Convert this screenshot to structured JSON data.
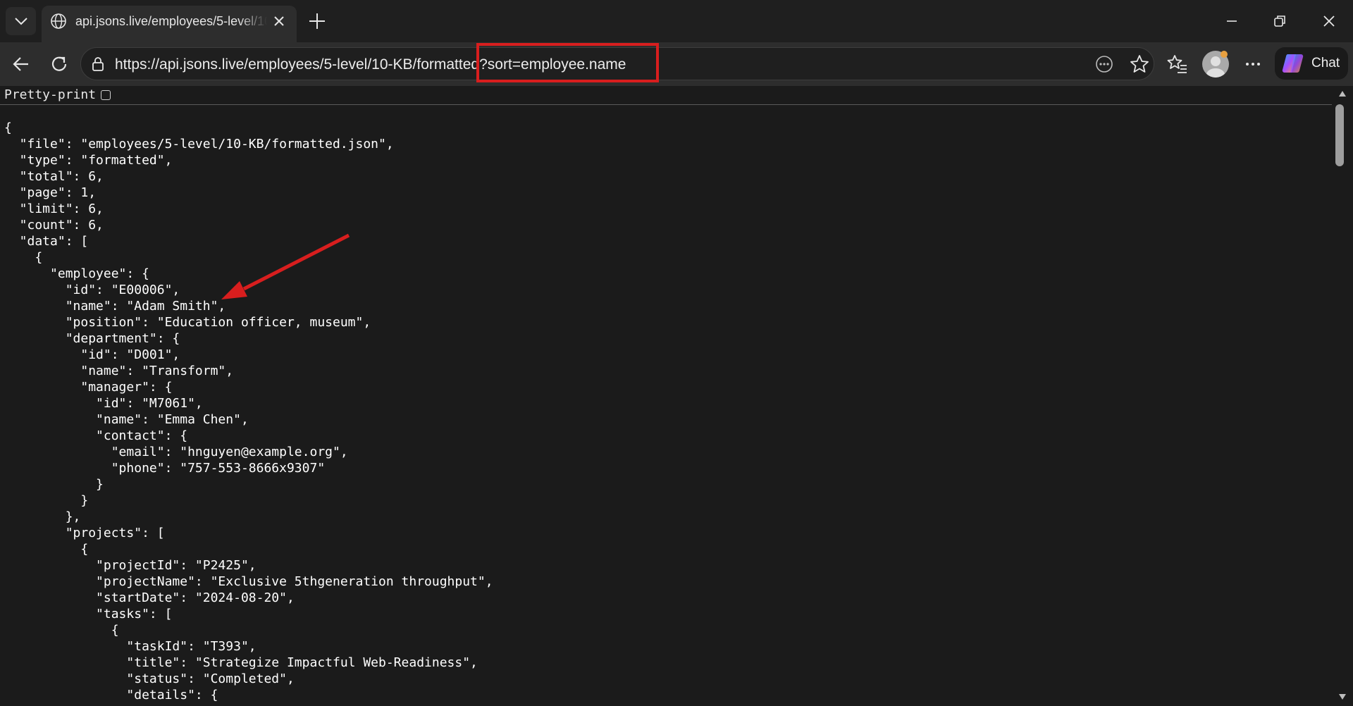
{
  "tab": {
    "title": "api.jsons.live/employees/5-level/10-KB/formatted?sort=employee.name"
  },
  "toolbar": {
    "url": "https://api.jsons.live/employees/5-level/10-KB/formatted?sort=employee.name",
    "chat_label": "Chat"
  },
  "content": {
    "pretty_print_label": "Pretty-print",
    "pretty_print_checked": false,
    "json_lines": [
      "{",
      "  \"file\": \"employees/5-level/10-KB/formatted.json\",",
      "  \"type\": \"formatted\",",
      "  \"total\": 6,",
      "  \"page\": 1,",
      "  \"limit\": 6,",
      "  \"count\": 6,",
      "  \"data\": [",
      "    {",
      "      \"employee\": {",
      "        \"id\": \"E00006\",",
      "        \"name\": \"Adam Smith\",",
      "        \"position\": \"Education officer, museum\",",
      "        \"department\": {",
      "          \"id\": \"D001\",",
      "          \"name\": \"Transform\",",
      "          \"manager\": {",
      "            \"id\": \"M7061\",",
      "            \"name\": \"Emma Chen\",",
      "            \"contact\": {",
      "              \"email\": \"hnguyen@example.org\",",
      "              \"phone\": \"757-553-8666x9307\"",
      "            }",
      "          }",
      "        },",
      "        \"projects\": [",
      "          {",
      "            \"projectId\": \"P2425\",",
      "            \"projectName\": \"Exclusive 5thgeneration throughput\",",
      "            \"startDate\": \"2024-08-20\",",
      "            \"tasks\": [",
      "              {",
      "                \"taskId\": \"T393\",",
      "                \"title\": \"Strategize Impactful Web-Readiness\",",
      "                \"status\": \"Completed\",",
      "                \"details\": {"
    ]
  },
  "colors": {
    "annotation": "#d81e1e",
    "background": "#1b1b1b"
  }
}
